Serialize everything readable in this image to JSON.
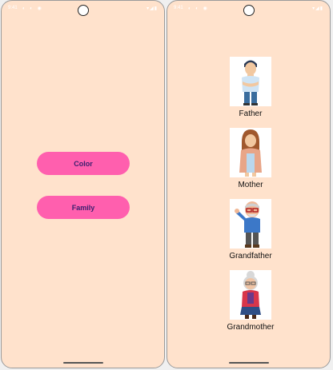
{
  "left_screen": {
    "status": {
      "time": "9:41",
      "icons": "◐ ◐ ◉",
      "right_icons": "▾◢▮"
    },
    "buttons": [
      {
        "label": "Color"
      },
      {
        "label": "Family"
      }
    ]
  },
  "right_screen": {
    "status": {
      "time": "9:41",
      "icons": "◐ ◐ ◉",
      "right_icons": "▾◢▮"
    },
    "members": [
      {
        "name": "Father"
      },
      {
        "name": "Mother"
      },
      {
        "name": "Grandfather"
      },
      {
        "name": "Grandmother"
      }
    ]
  },
  "colors": {
    "background": "#ffe2cc",
    "button": "#ff5fae",
    "button_text": "#3b1f6e"
  }
}
